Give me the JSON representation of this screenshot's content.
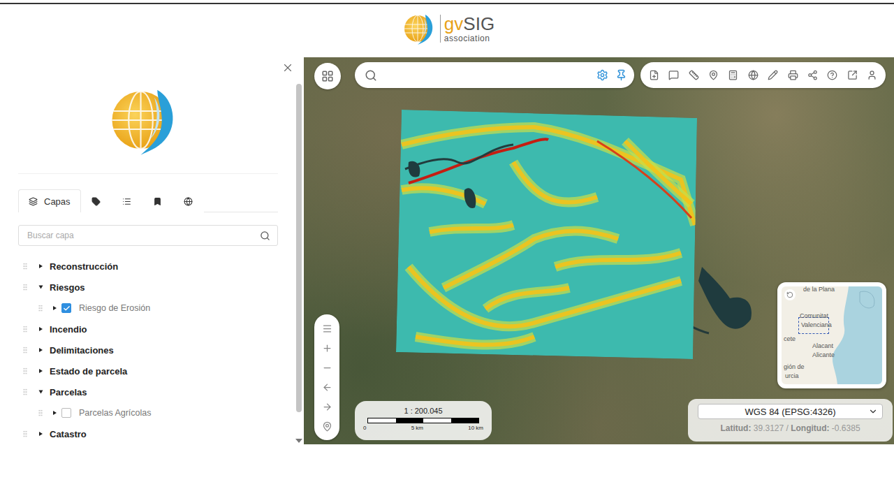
{
  "header": {
    "logo": {
      "prefix": "gv",
      "name": "SIG",
      "subtitle": "association"
    }
  },
  "sidebar": {
    "tabs": [
      {
        "label": "Capas",
        "selected": true
      },
      {
        "label": "",
        "selected": false
      },
      {
        "label": "",
        "selected": false
      },
      {
        "label": "",
        "selected": false
      },
      {
        "label": "",
        "selected": false
      }
    ],
    "search": {
      "placeholder": "Buscar capa"
    },
    "layers": [
      {
        "name": "Reconstrucción",
        "expanded": false,
        "children": []
      },
      {
        "name": "Riesgos",
        "expanded": true,
        "children": [
          {
            "name": "Riesgo de Erosión",
            "expanded": false,
            "checked": true
          }
        ]
      },
      {
        "name": "Incendio",
        "expanded": false,
        "children": []
      },
      {
        "name": "Delimitaciones",
        "expanded": false,
        "children": []
      },
      {
        "name": "Estado de parcela",
        "expanded": false,
        "children": []
      },
      {
        "name": "Parcelas",
        "expanded": true,
        "children": [
          {
            "name": "Parcelas Agrícolas",
            "expanded": false,
            "checked": false
          }
        ]
      },
      {
        "name": "Catastro",
        "expanded": false,
        "children": []
      }
    ]
  },
  "map": {
    "scale": {
      "ratio": "1 : 200.045",
      "ticks": [
        "0",
        "5 km",
        "10 km"
      ]
    },
    "minimap": {
      "labels": [
        "de la Plana",
        "Comunitat",
        "Valenciana",
        "cete",
        "Alacant",
        "Alicante",
        "gión de",
        "urcia"
      ]
    },
    "projection": {
      "value": "WGS 84 (EPSG:4326)"
    },
    "coordinates": {
      "lat_label": "Latitud:",
      "lat": "39.3127",
      "separator": "/",
      "lon_label": "Longitud:",
      "lon": "-0.6385"
    }
  }
}
